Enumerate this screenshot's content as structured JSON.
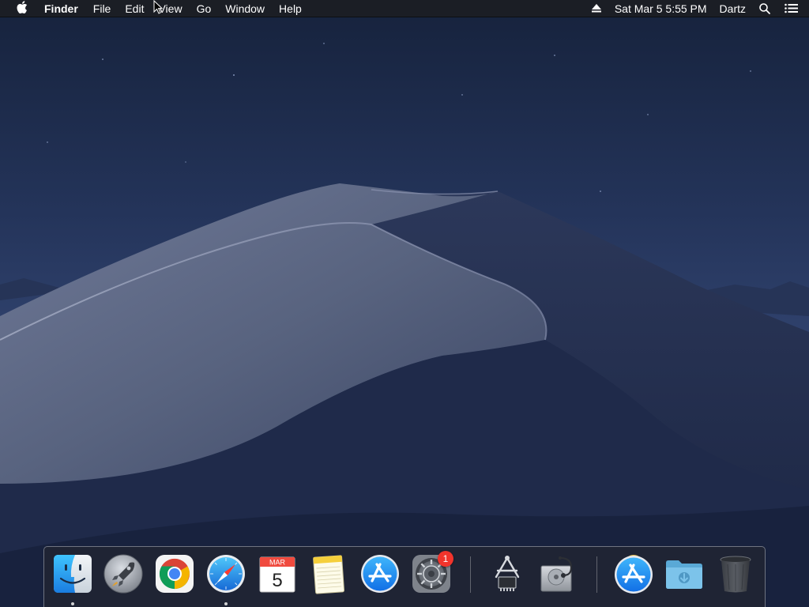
{
  "menubar": {
    "apple_icon": "apple-icon",
    "app_name": "Finder",
    "menus": [
      "File",
      "Edit",
      "View",
      "Go",
      "Window",
      "Help"
    ],
    "status": {
      "eject_icon": "eject-icon",
      "datetime": "Sat Mar 5  5:55 PM",
      "user": "Dartz",
      "spotlight_icon": "search-icon",
      "notification_icon": "list-icon"
    }
  },
  "wallpaper": {
    "name": "Mojave Night",
    "sky_color": "#1e2b4a",
    "dune_color": "#5d6886"
  },
  "dock": {
    "apps": [
      {
        "name": "Finder",
        "icon": "finder-icon",
        "running": true
      },
      {
        "name": "Launchpad",
        "icon": "launchpad-icon",
        "running": false
      },
      {
        "name": "Google Chrome",
        "icon": "chrome-icon",
        "running": false
      },
      {
        "name": "Safari",
        "icon": "safari-icon",
        "running": true
      },
      {
        "name": "Calendar",
        "icon": "calendar-icon",
        "running": false,
        "month": "MAR",
        "day": "5"
      },
      {
        "name": "Notes",
        "icon": "notes-icon",
        "running": false
      },
      {
        "name": "App Store",
        "icon": "app-store-icon",
        "running": false
      },
      {
        "name": "System Preferences",
        "icon": "gear-icon",
        "running": false,
        "badge": "1"
      },
      {
        "name": "System Information",
        "icon": "system-information-icon",
        "running": false
      },
      {
        "name": "Disk Utility",
        "icon": "disk-utility-icon",
        "running": false
      }
    ],
    "stacks": [
      {
        "name": "Applications",
        "icon": "app-store-stack-icon"
      },
      {
        "name": "Downloads",
        "icon": "downloads-folder-icon"
      },
      {
        "name": "Trash",
        "icon": "trash-icon"
      }
    ],
    "colors": {
      "badge": "#f2342c",
      "app_store_blue": "#1d8af0",
      "chrome_red": "#db4437",
      "chrome_green": "#0f9d58",
      "chrome_yellow": "#f4b400",
      "chrome_blue": "#4285f4"
    }
  }
}
